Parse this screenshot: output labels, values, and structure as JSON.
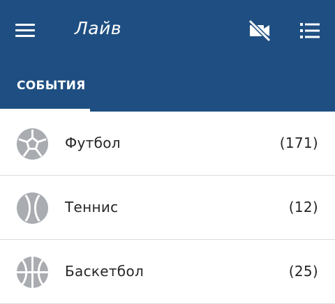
{
  "header": {
    "title": "Лайв",
    "background_color": "#1f4f82",
    "menu_icon": "hamburger-menu-icon",
    "actions": [
      {
        "icon": "video-off-icon"
      },
      {
        "icon": "list-icon"
      }
    ]
  },
  "tabs": [
    {
      "label": "СОБЫТИЯ",
      "active": true
    }
  ],
  "sports": [
    {
      "name": "Футбол",
      "count": "(171)",
      "icon": "football-icon"
    },
    {
      "name": "Теннис",
      "count": "(12)",
      "icon": "tennis-ball-icon"
    },
    {
      "name": "Баскетбол",
      "count": "(25)",
      "icon": "basketball-icon"
    }
  ],
  "colors": {
    "icon_gray": "#a9acb0",
    "text": "#262626",
    "divider": "#dcdcdc"
  }
}
